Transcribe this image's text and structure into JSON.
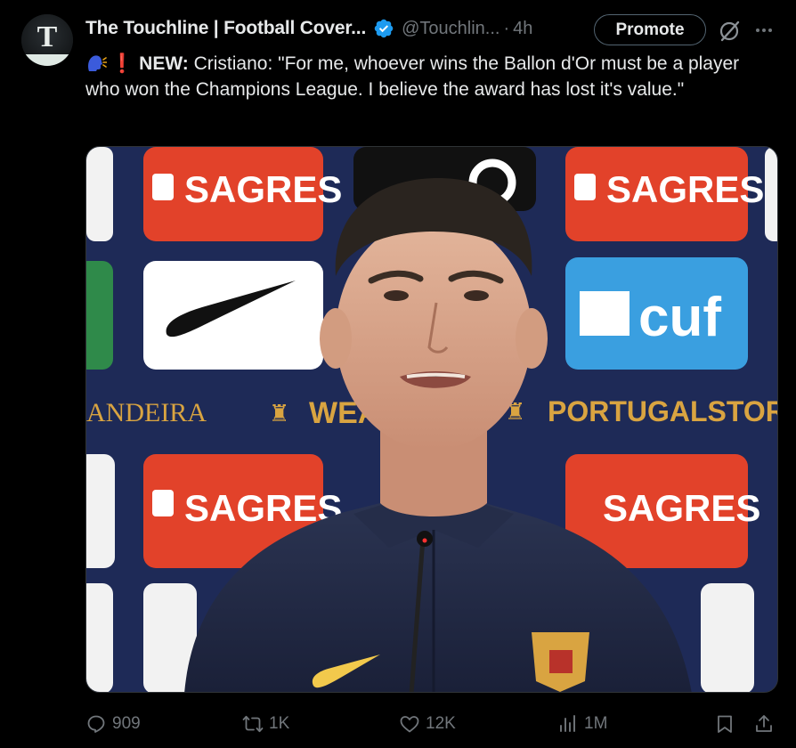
{
  "account": {
    "display_name": "The Touchline | Football Cover...",
    "handle": "@Touchlin...",
    "separator": "·",
    "time": "4h",
    "avatar_letter": "T",
    "verified_icon": "verified-badge-icon",
    "verified_color": "#1d9bf0"
  },
  "header_actions": {
    "promote_label": "Promote",
    "grok_icon": "grok-icon",
    "more_icon": "more-icon"
  },
  "tweet": {
    "emoji_1": "speaking-head-emoji",
    "emoji_2": "❗",
    "prefix": "NEW:",
    "body": " Cristiano: \"For me, whoever wins the Ballon d'Or must be a player who won the Champions League. I believe the award has lost it's value.\""
  },
  "media": {
    "sponsor_1": "SAGRES",
    "sponsor_2": "SAGRES",
    "sponsor_3": "SAGRES",
    "sponsor_4": "SAGRES",
    "sponsor_cuf": "cuf",
    "banner_left": "ANDEIRA",
    "banner_mid": "WEAR",
    "banner_right": "PORTUGALSTORE.FPF.I"
  },
  "engagement": {
    "replies": "909",
    "reposts": "1K",
    "likes": "12K",
    "views": "1M"
  },
  "colors": {
    "background": "#000000",
    "text_primary": "#e7e9ea",
    "text_secondary": "#71767b",
    "accent": "#1d9bf0",
    "sagres_red": "#e2422a",
    "backdrop_navy": "#1e2a57"
  }
}
